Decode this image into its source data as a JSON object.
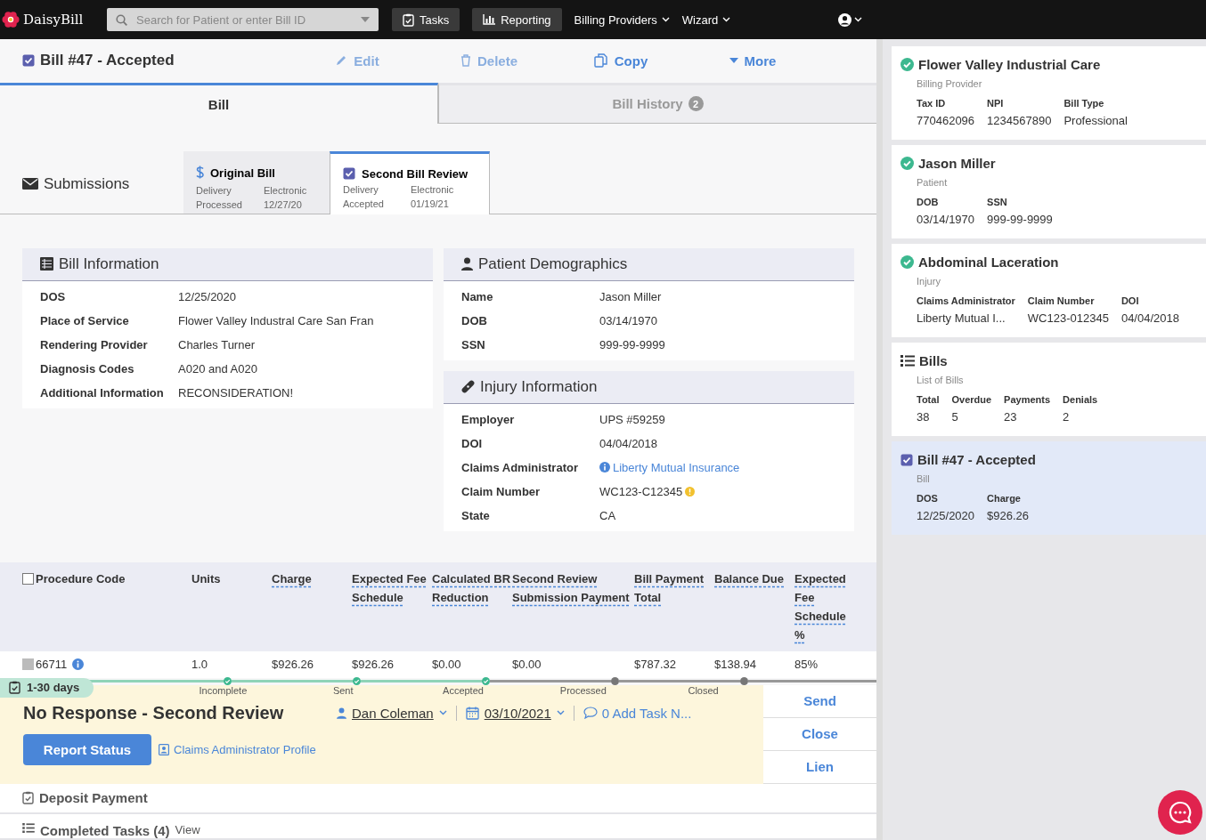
{
  "topbar": {
    "logo": "DaisyBill",
    "search": {
      "placeholder": "Search for Patient or enter Bill ID"
    },
    "nav": [
      {
        "label": "Tasks",
        "kind": "tasks"
      },
      {
        "label": "Reporting",
        "kind": "reporting"
      },
      {
        "label": "Billing Providers",
        "kind": "menu"
      },
      {
        "label": "Wizard",
        "kind": "menu"
      }
    ]
  },
  "bill": {
    "title": "Bill #47 - Accepted",
    "actions": [
      {
        "label": "Edit",
        "kind": "edit",
        "disabled": true
      },
      {
        "label": "Delete",
        "kind": "delete",
        "disabled": true
      },
      {
        "label": "Copy",
        "kind": "copy",
        "disabled": false
      },
      {
        "label": "More",
        "kind": "more",
        "disabled": false
      }
    ]
  },
  "tabs": [
    {
      "label": "Bill",
      "selected": true
    },
    {
      "label": "Bill History",
      "selected": false,
      "badge": "2"
    }
  ],
  "submissions": {
    "label": "Submissions",
    "items": [
      {
        "title": "Original Bill",
        "kind": "payment",
        "selected": false,
        "fields": [
          {
            "label": "Delivery",
            "value": "Electronic"
          },
          {
            "label": "Processed",
            "value": "12/27/20"
          }
        ]
      },
      {
        "title": "Second Bill Review",
        "kind": "review",
        "selected": true,
        "fields": [
          {
            "label": "Delivery",
            "value": "Electronic"
          },
          {
            "label": "Accepted",
            "value": "01/19/21"
          }
        ]
      }
    ]
  },
  "bill_information": {
    "title": "Bill Information",
    "rows": [
      {
        "label": "DOS",
        "value": "12/25/2020",
        "kind": "text"
      },
      {
        "label": "Place of Service",
        "value": "Flower Valley Industral Care San Fran",
        "kind": "text"
      },
      {
        "label": "Rendering Provider",
        "value": "Charles Turner",
        "kind": "text"
      },
      {
        "label": "Diagnosis Codes",
        "value": "A020 and A020",
        "kind": "text"
      },
      {
        "label": "Additional Information",
        "value": "RECONSIDERATION!",
        "kind": "text"
      }
    ]
  },
  "patient_demographics": {
    "title": "Patient Demographics",
    "rows": [
      {
        "label": "Name",
        "value": "Jason Miller",
        "kind": "text"
      },
      {
        "label": "DOB",
        "value": "03/14/1970",
        "kind": "text"
      },
      {
        "label": "SSN",
        "value": "999-99-9999",
        "kind": "text"
      }
    ]
  },
  "injury_information": {
    "title": "Injury Information",
    "rows": [
      {
        "label": "Employer",
        "value": "UPS #59259",
        "kind": "text"
      },
      {
        "label": "DOI",
        "value": "04/04/2018",
        "kind": "text"
      },
      {
        "label": "Claims Administrator",
        "value": "Liberty Mutual Insurance",
        "kind": "link"
      },
      {
        "label": "Claim Number",
        "value": "WC123-C12345",
        "kind": "warning"
      },
      {
        "label": "State",
        "value": "CA",
        "kind": "text"
      }
    ]
  },
  "procedures": {
    "select_all_checked": false,
    "columns": [
      {
        "label": "Procedure Code",
        "dotted": false
      },
      {
        "label": "Units",
        "dotted": false
      },
      {
        "label": "Charge",
        "dotted": true
      },
      {
        "label": "Expected Fee Schedule",
        "dotted": true
      },
      {
        "label": "Calculated BR Reduction",
        "dotted": true
      },
      {
        "label": "Second Review Submission Payment",
        "dotted": true
      },
      {
        "label": "Bill Payment Total",
        "dotted": true
      },
      {
        "label": "Balance Due",
        "dotted": true
      },
      {
        "label": "Expected Fee Schedule %",
        "dotted": true
      }
    ],
    "rows": [
      {
        "checked": true,
        "cells": [
          "66711",
          "1.0",
          "$926.26",
          "$926.26",
          "$0.00",
          "$0.00",
          "$787.32",
          "$138.94",
          "85%"
        ]
      }
    ]
  },
  "task": {
    "age": "1-30 days",
    "steps": [
      {
        "label": "Incomplete",
        "done": true
      },
      {
        "label": "Sent",
        "done": true
      },
      {
        "label": "Accepted",
        "done": true
      },
      {
        "label": "Processed",
        "done": false
      },
      {
        "label": "Closed",
        "done": false
      }
    ],
    "title": "No Response - Second Review",
    "assignee": "Dan Coleman",
    "due_date": "03/10/2021",
    "notes": "0 Add Task N...",
    "primary_action": "Report Status",
    "link": "Claims Administrator Profile",
    "actions": [
      "Send",
      "Close",
      "Lien"
    ]
  },
  "deposit_payment": "Deposit Payment",
  "completed_tasks": {
    "label": "Completed Tasks (4)",
    "link": "View"
  },
  "sidebar": {
    "cards": [
      {
        "kind": "check",
        "title": "Flower Valley Industrial Care",
        "subtitle": "Billing Provider",
        "selected": false,
        "fields": [
          {
            "label": "Tax ID",
            "value": "770462096"
          },
          {
            "label": "NPI",
            "value": "1234567890"
          },
          {
            "label": "Bill Type",
            "value": "Professional"
          }
        ]
      },
      {
        "kind": "check",
        "title": "Jason Miller",
        "subtitle": "Patient",
        "selected": false,
        "fields": [
          {
            "label": "DOB",
            "value": "03/14/1970"
          },
          {
            "label": "SSN",
            "value": "999-99-9999"
          }
        ]
      },
      {
        "kind": "check",
        "title": "Abdominal Laceration",
        "subtitle": "Injury",
        "selected": false,
        "fields": [
          {
            "label": "Claims Administrator",
            "value": "Liberty Mutual I..."
          },
          {
            "label": "Claim Number",
            "value": "WC123-012345"
          },
          {
            "label": "DOI",
            "value": "04/04/2018"
          }
        ]
      },
      {
        "kind": "list",
        "title": "Bills",
        "subtitle": "List of Bills",
        "selected": false,
        "fields": [
          {
            "label": "Total",
            "value": "38"
          },
          {
            "label": "Overdue",
            "value": "5"
          },
          {
            "label": "Payments",
            "value": "23"
          },
          {
            "label": "Denials",
            "value": "2"
          }
        ]
      },
      {
        "kind": "checkbox",
        "title": "Bill #47 - Accepted",
        "subtitle": "Bill",
        "selected": true,
        "fields": [
          {
            "label": "DOS",
            "value": "12/25/2020"
          },
          {
            "label": "Charge",
            "value": "$926.26"
          }
        ]
      }
    ]
  }
}
